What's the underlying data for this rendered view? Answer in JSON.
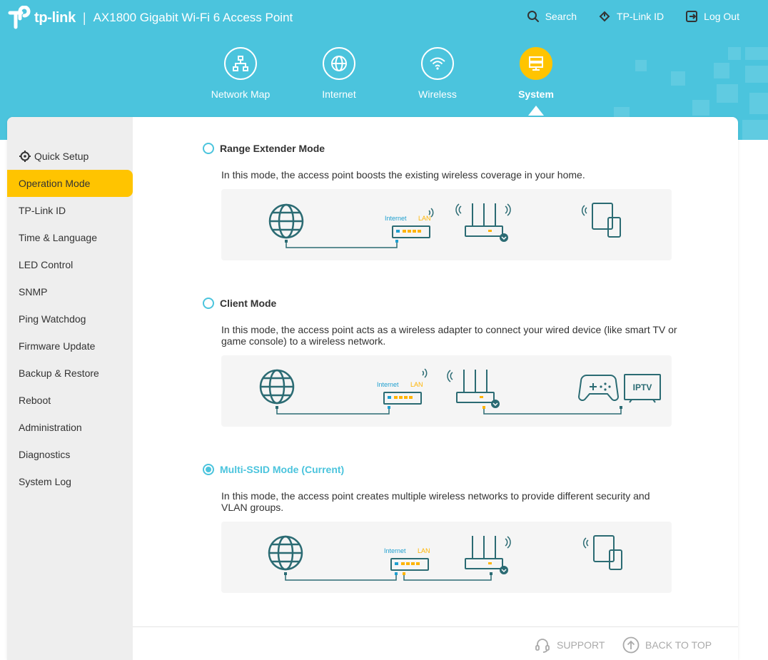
{
  "header": {
    "brand": "tp-link",
    "product": "AX1800 Gigabit Wi-Fi 6 Access Point",
    "actions": [
      {
        "label": "Search",
        "icon": "search-icon"
      },
      {
        "label": "TP-Link ID",
        "icon": "tplink-id-icon"
      },
      {
        "label": "Log Out",
        "icon": "logout-icon"
      }
    ],
    "accent_color": "#4bc4dd",
    "active_color": "#ffc400"
  },
  "nav": {
    "items": [
      {
        "label": "Network Map",
        "icon": "network-map-icon"
      },
      {
        "label": "Internet",
        "icon": "globe-icon"
      },
      {
        "label": "Wireless",
        "icon": "wifi-icon"
      },
      {
        "label": "System",
        "icon": "system-icon",
        "active": true
      }
    ]
  },
  "sidebar": {
    "items": [
      {
        "label": "Quick Setup",
        "icon": "gear-icon"
      },
      {
        "label": "Operation Mode",
        "active": true
      },
      {
        "label": "TP-Link ID"
      },
      {
        "label": "Time & Language"
      },
      {
        "label": "LED Control"
      },
      {
        "label": "SNMP"
      },
      {
        "label": "Ping Watchdog"
      },
      {
        "label": "Firmware Update"
      },
      {
        "label": "Backup & Restore"
      },
      {
        "label": "Reboot"
      },
      {
        "label": "Administration"
      },
      {
        "label": "Diagnostics"
      },
      {
        "label": "System Log"
      }
    ]
  },
  "modes": [
    {
      "title": "Range Extender Mode",
      "description": "In this mode, the access point boosts the existing wireless coverage in your home.",
      "selected": false,
      "diagram": {
        "internet_label": "Internet",
        "lan_label": "LAN"
      }
    },
    {
      "title": "Client Mode",
      "description": "In this mode, the access point acts as a wireless adapter to connect your wired device (like smart TV or game console) to a wireless network.",
      "selected": false,
      "diagram": {
        "internet_label": "Internet",
        "lan_label": "LAN",
        "tv_label": "IPTV"
      }
    },
    {
      "title": "Multi-SSID Mode (Current)",
      "description": "In this mode, the access point creates multiple wireless networks to provide different security and VLAN groups.",
      "selected": true,
      "diagram": {
        "internet_label": "Internet",
        "lan_label": "LAN"
      }
    }
  ],
  "footer": {
    "support": "SUPPORT",
    "back_to_top": "BACK TO TOP"
  }
}
